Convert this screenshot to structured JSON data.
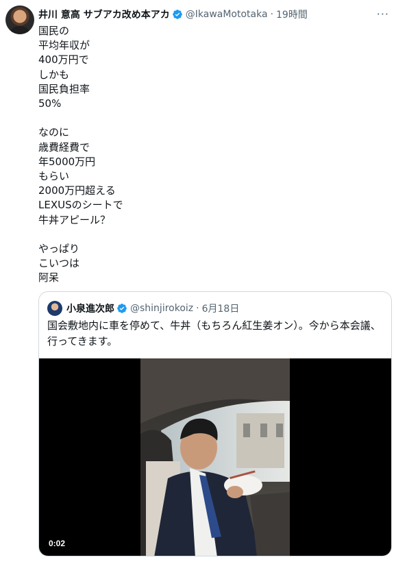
{
  "tweet": {
    "author_name": "井川 意高 サブアカ改め本アカ",
    "handle": "@IkawaMototaka",
    "time": "19時間",
    "text": "国民の\n平均年収が\n400万円で\nしかも\n国民負担率\n50%\n\nなのに\n歳費経費で\n年5000万円\nもらい\n2000万円超える\nLEXUSのシートで\n牛丼アピール？\n\nやっぱり\nこいつは\n阿呆",
    "more_label": "···"
  },
  "quoted": {
    "author_name": "小泉進次郎",
    "handle": "@shinjirokoiz",
    "date": "6月18日",
    "text": "国会敷地内に車を停めて、牛丼（もちろん紅生姜オン）。今から本会議、行ってきます。",
    "video_time": "0:02"
  },
  "colors": {
    "verified": "#1d9bf0",
    "secondary_text": "#536471",
    "border": "#cfd9de"
  },
  "icons": [
    "verified-icon",
    "more-icon"
  ]
}
